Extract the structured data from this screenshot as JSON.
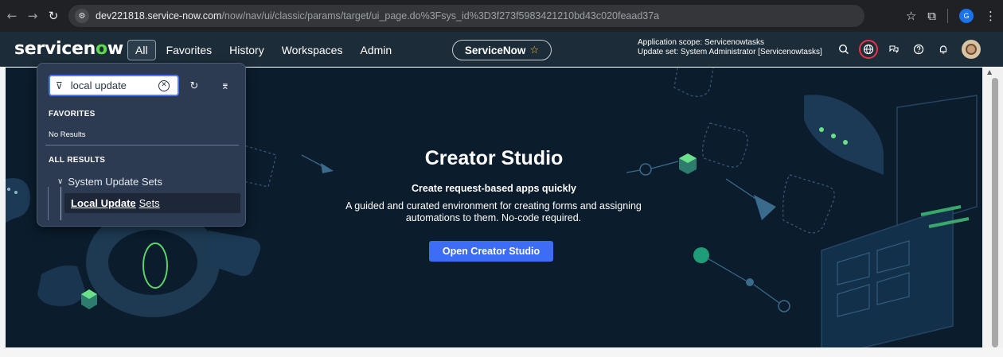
{
  "browser": {
    "url_host": "dev221818.service-now.com",
    "url_path": "/now/nav/ui/classic/params/target/ui_page.do%3Fsys_id%3D3f273f5983421210bd43c020feaad37a",
    "profile_initial": "G"
  },
  "header": {
    "logo_pre": "servicen",
    "logo_o": "o",
    "logo_post": "w",
    "nav": {
      "all": "All",
      "favorites": "Favorites",
      "history": "History",
      "workspaces": "Workspaces",
      "admin": "Admin"
    },
    "instance_label": "ServiceNow",
    "scope_line1": "Application scope: Servicenowtasks",
    "scope_line2": "Update set: System Administrator [Servicenowtasks]"
  },
  "menu": {
    "filter_value": "local update",
    "favorites_heading": "FAVORITES",
    "favorites_empty": "No Results",
    "all_results_heading": "ALL RESULTS",
    "parent_label": "System Update Sets",
    "child_highlight": "Local Update",
    "child_rest": "Sets"
  },
  "hero": {
    "title": "Creator Studio",
    "subtitle": "Create request-based apps quickly",
    "description": "A guided and curated environment for creating forms and assigning automations to them. No-code required.",
    "button_label": "Open Creator Studio"
  },
  "colors": {
    "header_bg": "#1c2c38",
    "hero_bg": "#0b1c2c",
    "accent_button": "#3d6cf5",
    "logo_green": "#62d84e",
    "menu_bg": "#2c3a52"
  }
}
